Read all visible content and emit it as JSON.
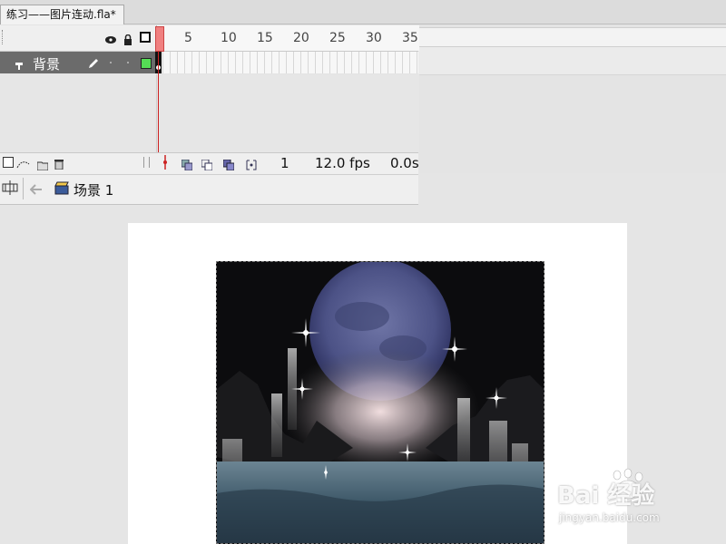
{
  "tab": {
    "title": "练习——图片连动.fla*"
  },
  "timeline": {
    "ruler_numbers": [
      "5",
      "10",
      "15",
      "20",
      "25",
      "30",
      "35"
    ],
    "layer": {
      "name": "背景",
      "color": "#55dd55"
    },
    "current_frame": "1",
    "frame_rate": "12.0 fps",
    "elapsed_time": "0.0s"
  },
  "editbar": {
    "scene_label": "场景 1"
  },
  "watermark": {
    "text": "Bai 经验",
    "url": "jingyan.baidu.com"
  },
  "colors": {
    "playhead": "#cc2222",
    "stage": "#ffffff",
    "workspace": "#e5e5e5",
    "layer_row": "#6b6b6b"
  }
}
